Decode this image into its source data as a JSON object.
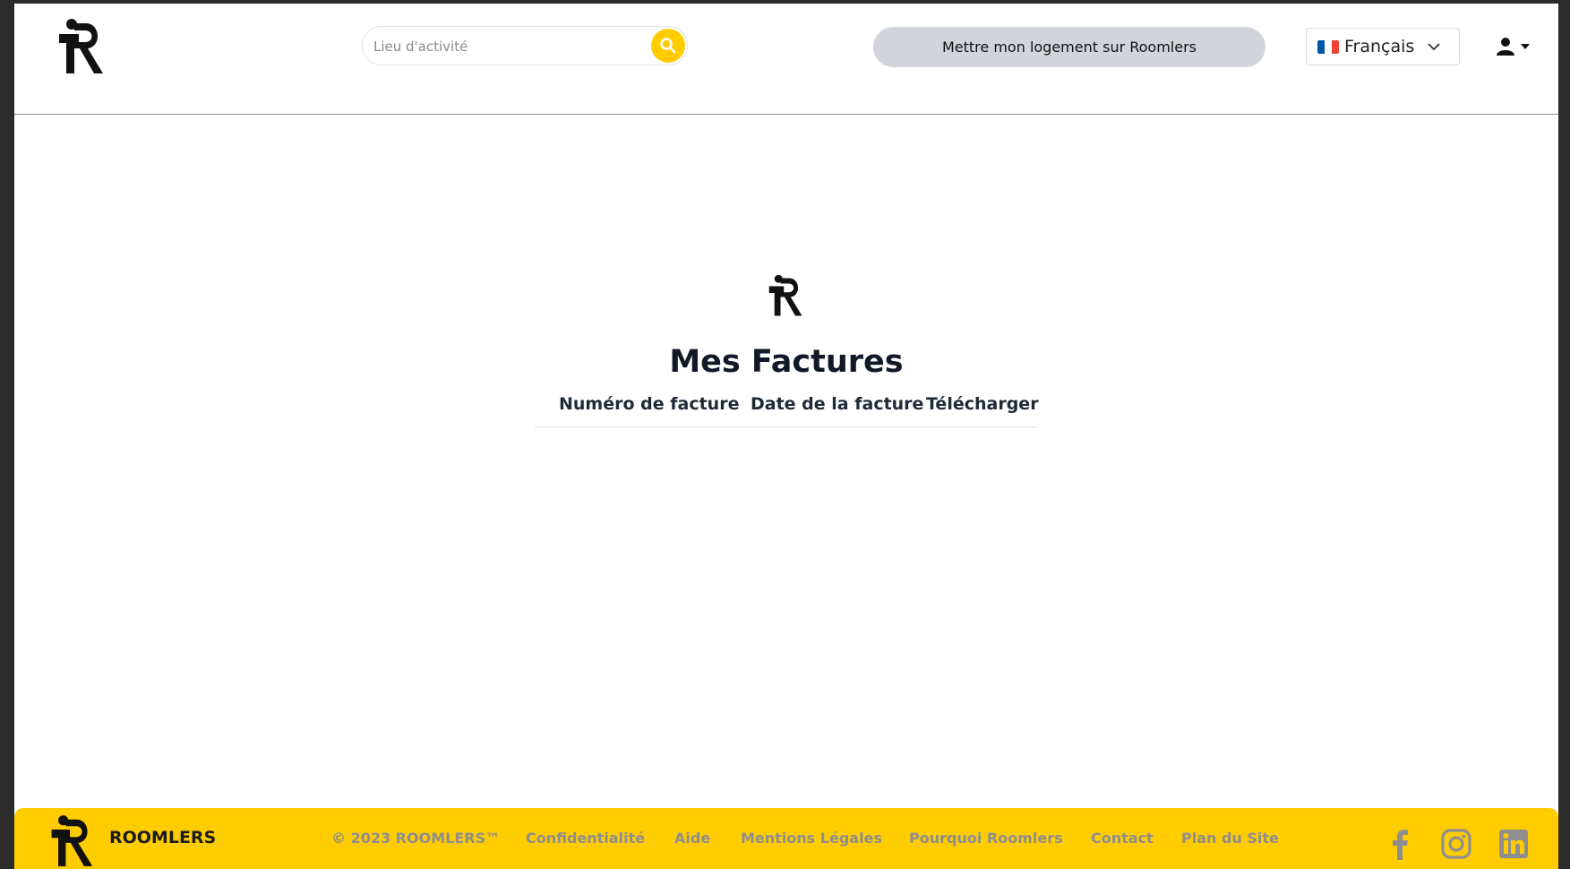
{
  "header": {
    "search": {
      "placeholder": "Lieu d'activité"
    },
    "host_button_label": "Mettre mon logement sur Roomlers",
    "language": {
      "selected": "Français",
      "flag": "fr"
    }
  },
  "main": {
    "title": "Mes Factures",
    "table": {
      "columns": [
        "Numéro de facture",
        "Date de la facture",
        "Télécharger"
      ],
      "rows": []
    }
  },
  "footer": {
    "brand": "ROOMLERS",
    "copyright": "© 2023 ROOMLERS™",
    "links": [
      "Confidentialité",
      "Aide",
      "Mentions Légales",
      "Pourquoi Roomlers",
      "Contact",
      "Plan du Site"
    ],
    "social": [
      "facebook-icon",
      "instagram-icon",
      "linkedin-icon"
    ]
  },
  "colors": {
    "accent": "#ffcc00",
    "host_button_bg": "#d1d5db",
    "title": "#111827",
    "footer_link": "#8e8e8e"
  }
}
